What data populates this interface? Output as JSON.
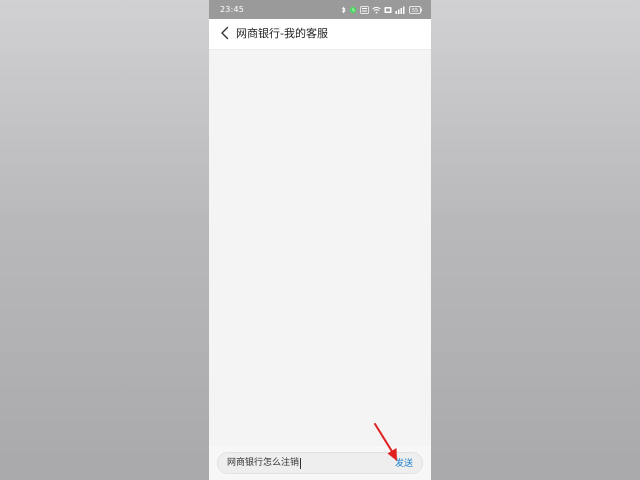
{
  "status_bar": {
    "time": "23:45",
    "battery": "55"
  },
  "header": {
    "back_icon": "chevron-left-icon",
    "title": "网商银行-我的客服"
  },
  "composer": {
    "input_value": "网商银行怎么注销",
    "send_label": "发送"
  },
  "colors": {
    "accent": "#1a7fd4",
    "status_bar_bg": "#9a9a9a",
    "chat_bg": "#f4f4f4",
    "annotation_arrow": "#e02020"
  },
  "icons": [
    "bluetooth-icon",
    "alarm-icon",
    "hd-icon",
    "wifi-icon",
    "sim-icon",
    "signal-icon",
    "battery-icon",
    "chevron-left-icon",
    "annotation-arrow-icon"
  ]
}
